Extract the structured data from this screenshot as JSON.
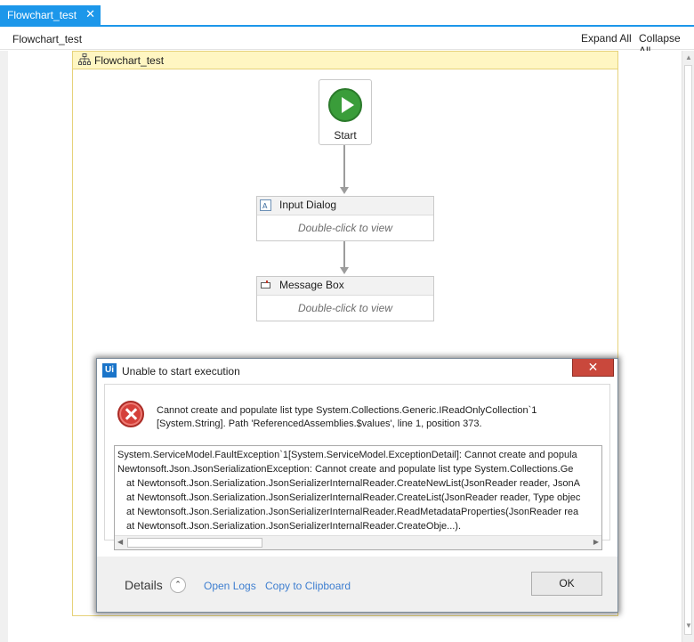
{
  "tab": {
    "label": "Flowchart_test",
    "close_glyph": "✕"
  },
  "header": {
    "breadcrumb": "Flowchart_test",
    "expand_all": "Expand All",
    "collapse_all": "Collapse All"
  },
  "flowchart": {
    "title": "Flowchart_test",
    "start_label": "Start",
    "activities": [
      {
        "name": "Input Dialog",
        "hint": "Double-click to view",
        "icon": "input-dialog-icon"
      },
      {
        "name": "Message Box",
        "hint": "Double-click to view",
        "icon": "message-box-icon"
      }
    ]
  },
  "dialog": {
    "app_icon_text": "Ui",
    "title": "Unable to start execution",
    "close_glyph": "✕",
    "message_line1": "Cannot create and populate list type System.Collections.Generic.IReadOnlyCollection`1",
    "message_line2": "[System.String]. Path 'ReferencedAssemblies.$values', line 1, position 373.",
    "details_lines": [
      "System.ServiceModel.FaultException`1[System.ServiceModel.ExceptionDetail]: Cannot create and popula",
      "Newtonsoft.Json.JsonSerializationException: Cannot create and populate list type System.Collections.Ge",
      "at Newtonsoft.Json.Serialization.JsonSerializerInternalReader.CreateNewList(JsonReader reader, JsonA",
      "at Newtonsoft.Json.Serialization.JsonSerializerInternalReader.CreateList(JsonReader reader, Type objec",
      "at Newtonsoft.Json.Serialization.JsonSerializerInternalReader.ReadMetadataProperties(JsonReader rea",
      "at Newtonsoft.Json.Serialization.JsonSerializerInternalReader.CreateObje...)."
    ],
    "details_label": "Details",
    "details_toggle_glyph": "⌃",
    "open_logs": "Open Logs",
    "copy_clipboard": "Copy to Clipboard",
    "ok": "OK"
  },
  "colors": {
    "accent": "#1c97ea",
    "flowchart_header": "#fff6c2",
    "start_green": "#3a9d3a",
    "error_red": "#d5403a",
    "close_red": "#c9483c"
  }
}
